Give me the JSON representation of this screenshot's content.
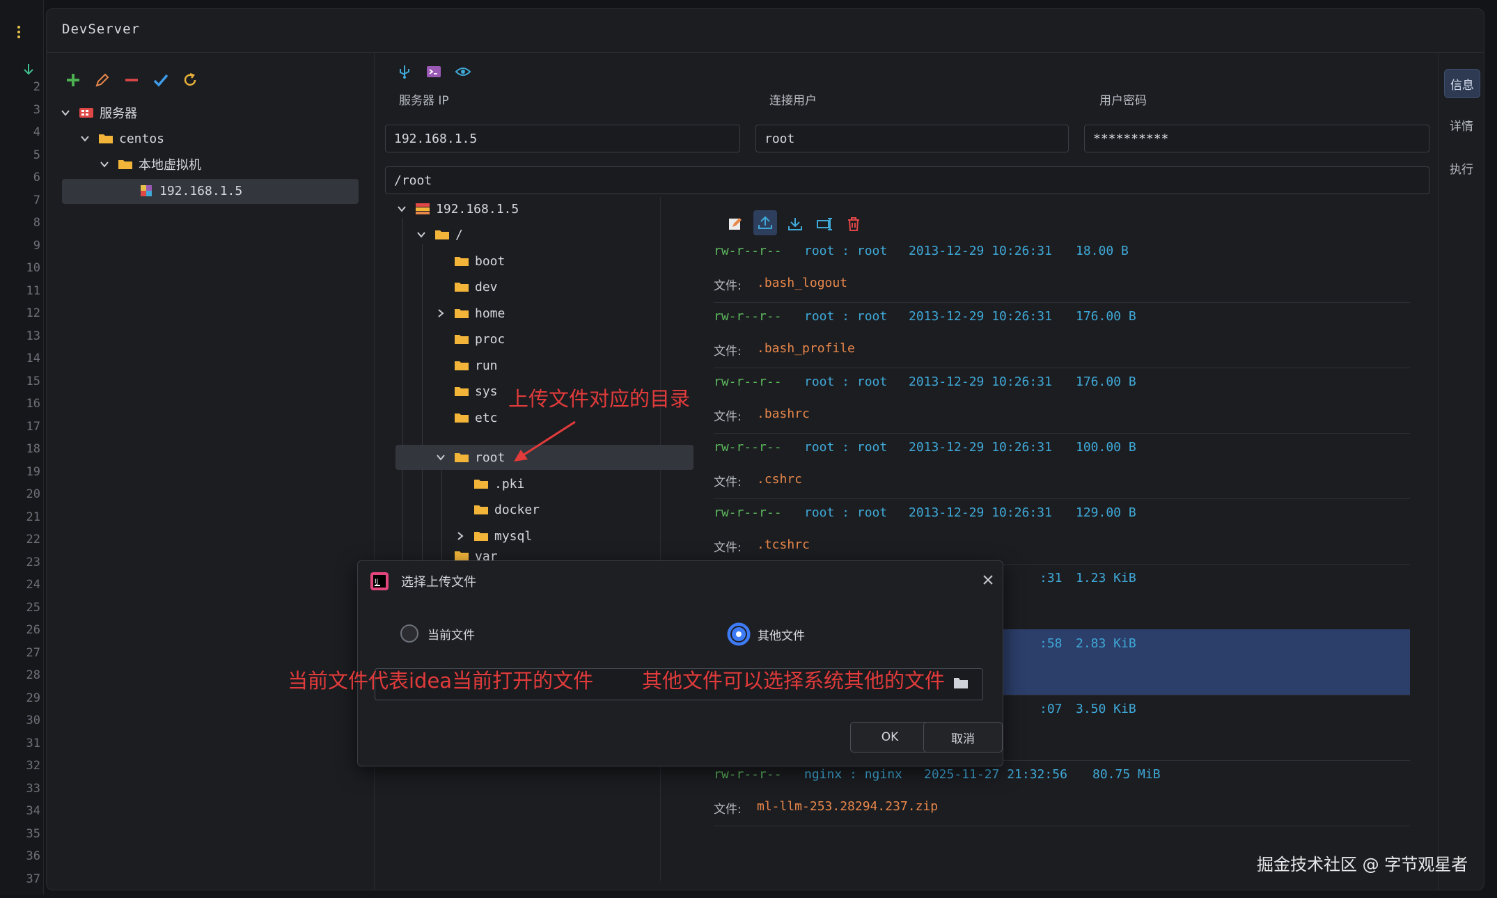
{
  "app": {
    "title": "DevServer"
  },
  "gutter": {
    "numbers": [
      "2",
      "3",
      "4",
      "5",
      "6",
      "7",
      "8",
      "9",
      "10",
      "11",
      "12",
      "13",
      "14",
      "15",
      "16",
      "17",
      "18",
      "19",
      "20",
      "21",
      "22",
      "23",
      "24",
      "25",
      "26",
      "27",
      "28",
      "29",
      "30",
      "31",
      "32",
      "33",
      "34",
      "35",
      "36",
      "37"
    ]
  },
  "server_tree": [
    {
      "label": "服务器",
      "level": 0,
      "icon": "server-group-icon"
    },
    {
      "label": "centos",
      "level": 1,
      "icon": "folder-icon"
    },
    {
      "label": "本地虚拟机",
      "level": 2,
      "icon": "folder-icon"
    },
    {
      "label": "192.168.1.5",
      "level": 3,
      "icon": "host-icon",
      "selected": true
    }
  ],
  "connection": {
    "ip_label": "服务器 IP",
    "user_label": "连接用户",
    "password_label": "用户密码",
    "ip_value": "192.168.1.5",
    "user_value": "root",
    "password_value": "**********",
    "path_value": "/root"
  },
  "side_tabs": [
    "信息",
    "详情",
    "执行"
  ],
  "file_tree": {
    "host": "192.168.1.5",
    "root": "/",
    "children": [
      "boot",
      "dev",
      "home",
      "proc",
      "run",
      "sys",
      "etc",
      "root"
    ],
    "root_children": [
      ".pki",
      "docker",
      "mysql"
    ],
    "partial": "var"
  },
  "files": [
    {
      "perm": "rw-r--r--",
      "owner": "root : root",
      "mtime": "2013-12-29 10:26:31",
      "size": "18.00 B",
      "label": "文件:",
      "name": ".bash_logout"
    },
    {
      "perm": "rw-r--r--",
      "owner": "root : root",
      "mtime": "2013-12-29 10:26:31",
      "size": "176.00 B",
      "label": "文件:",
      "name": ".bash_profile"
    },
    {
      "perm": "rw-r--r--",
      "owner": "root : root",
      "mtime": "2013-12-29 10:26:31",
      "size": "176.00 B",
      "label": "文件:",
      "name": ".bashrc"
    },
    {
      "perm": "rw-r--r--",
      "owner": "root : root",
      "mtime": "2013-12-29 10:26:31",
      "size": "100.00 B",
      "label": "文件:",
      "name": ".cshrc"
    },
    {
      "perm": "rw-r--r--",
      "owner": "root : root",
      "mtime": "2013-12-29 10:26:31",
      "size": "129.00 B",
      "label": "文件:",
      "name": ".tcshrc"
    },
    {
      "partial_time": ":31",
      "size": "1.23 KiB"
    },
    {
      "partial_time": ":58",
      "size": "2.83 KiB",
      "selected": true
    },
    {
      "partial_time": ":07",
      "size": "3.50 KiB"
    },
    {
      "perm": "rw-r--r--",
      "owner": "nginx : nginx",
      "mtime": "2025-11-27 21:32:56",
      "size": "80.75 MiB",
      "label": "文件:",
      "name": "ml-llm-253.28294.237.zip"
    }
  ],
  "dialog": {
    "title": "选择上传文件",
    "option_current": "当前文件",
    "option_other": "其他文件",
    "ok": "OK",
    "cancel": "取消"
  },
  "annotations": {
    "upload_dir": "上传文件对应的目录",
    "current_desc": "当前文件代表idea当前打开的文件",
    "other_desc": "其他文件可以选择系统其他的文件"
  },
  "watermark": "掘金技术社区 @ 字节观星者",
  "colors": {
    "accent": "#3d7bf7",
    "add": "#4caf50",
    "edit": "#e8874a",
    "remove": "#e04848",
    "check": "#3d9be9",
    "annotation": "#e23b3b"
  }
}
